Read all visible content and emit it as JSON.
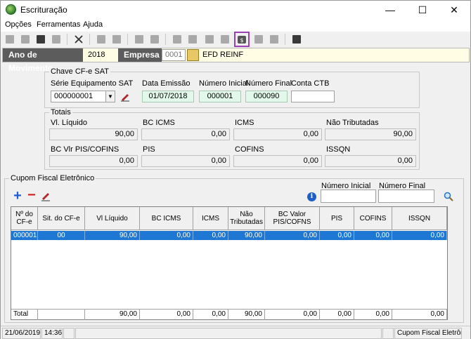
{
  "window": {
    "title": "Escrituração",
    "minimize": "—",
    "maximize": "☐",
    "close": "✕"
  },
  "menu": [
    "Opções",
    "Ferramentas",
    "Ajuda"
  ],
  "header": {
    "ano_label": "Ano de Movimento",
    "ano_value": "2018",
    "empresa_label": "Empresa",
    "empresa_value": "0001",
    "empresa_name": "EFD REINF"
  },
  "chave": {
    "title": "Chave CF-e SAT",
    "serie_label": "Série Equipamento SAT",
    "serie_value": "000000001",
    "data_label": "Data Emissão",
    "data_value": "01/07/2018",
    "num_ini_label": "Número Inicial",
    "num_ini_value": "000001",
    "num_fim_label": "Número Final",
    "num_fim_value": "000090",
    "conta_label": "Conta CTB",
    "conta_value": ""
  },
  "totais": {
    "title": "Totais",
    "fields": [
      {
        "label": "Vl. Líquido",
        "value": "90,00"
      },
      {
        "label": "BC ICMS",
        "value": "0,00"
      },
      {
        "label": "ICMS",
        "value": "0,00"
      },
      {
        "label": "Não Tributadas",
        "value": "90,00"
      },
      {
        "label": "BC Vlr PIS/COFINS",
        "value": "0,00"
      },
      {
        "label": "PIS",
        "value": "0,00"
      },
      {
        "label": "COFINS",
        "value": "0,00"
      },
      {
        "label": "ISSQN",
        "value": "0,00"
      }
    ]
  },
  "cupom": {
    "title": "Cupom Fiscal Eletrônico",
    "num_ini_label": "Número Inicial",
    "num_ini_value": "",
    "num_fim_label": "Número Final",
    "num_fim_value": "",
    "columns": [
      "Nº do CF-e",
      "Sit. do CF-e",
      "Vl Líquido",
      "BC ICMS",
      "ICMS",
      "Não Tributadas",
      "BC Valor PIS/COFNS",
      "PIS",
      "COFINS",
      "ISSQN"
    ],
    "rows": [
      [
        "000001",
        "00",
        "90,00",
        "0,00",
        "0,00",
        "90,00",
        "0,00",
        "0,00",
        "0,00",
        "0,00"
      ]
    ],
    "total": [
      "Total",
      "",
      "90,00",
      "0,00",
      "0,00",
      "90,00",
      "0,00",
      "0,00",
      "0,00",
      "0,00"
    ]
  },
  "status": {
    "date": "21/06/2019",
    "time": "14:36",
    "screen": "Cupom Fiscal Eletrônico"
  },
  "colors": {
    "accent": "#1e78d3",
    "selected_tool": "#9b3fb5",
    "header_dark": "#5c5c5c"
  }
}
